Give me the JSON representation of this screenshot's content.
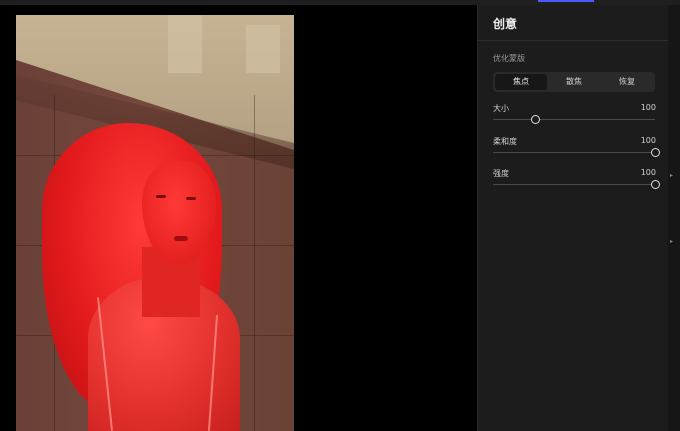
{
  "panel": {
    "title": "创意",
    "section_title": "优化蒙版",
    "modes": [
      {
        "label": "焦点",
        "active": true
      },
      {
        "label": "散焦",
        "active": false
      },
      {
        "label": "恢复",
        "active": false
      }
    ],
    "sliders": [
      {
        "label": "大小",
        "value": "100",
        "position": 0.26
      },
      {
        "label": "柔和度",
        "value": "100",
        "position": 1.0
      },
      {
        "label": "强度",
        "value": "100",
        "position": 1.0
      }
    ]
  },
  "colors": {
    "accent": "#4a5cff",
    "mask": "#e31a1c",
    "panel_bg": "#1c1c1c"
  },
  "icons": {
    "scroll_right": "chevron-right-icon"
  }
}
